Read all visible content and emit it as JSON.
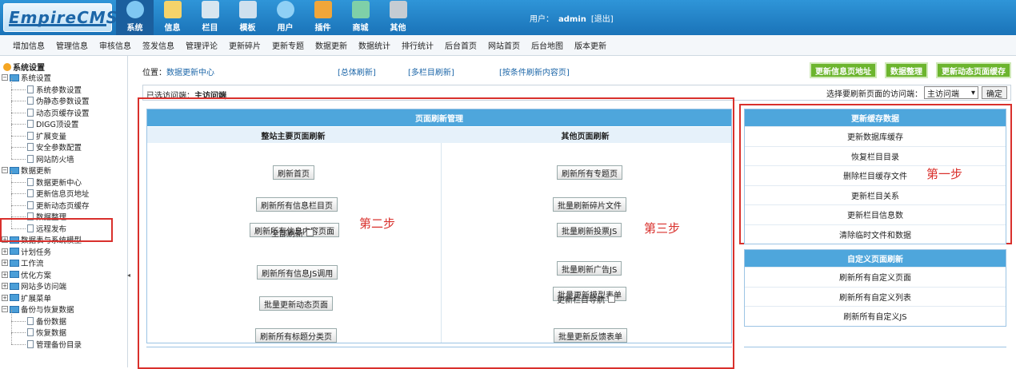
{
  "logo": {
    "text": "EmpireCMS"
  },
  "nav": [
    {
      "label": "系统",
      "icon": "globe-icon",
      "color": "#7fc7f2"
    },
    {
      "label": "信息",
      "icon": "edit-icon",
      "color": "#f5d36a"
    },
    {
      "label": "栏目",
      "icon": "folder-icon",
      "color": "#d7e6f0"
    },
    {
      "label": "模板",
      "icon": "template-icon",
      "color": "#cfe0ee"
    },
    {
      "label": "用户",
      "icon": "user-icon",
      "color": "#8fd0f5"
    },
    {
      "label": "插件",
      "icon": "tools-icon",
      "color": "#f0a63a"
    },
    {
      "label": "商城",
      "icon": "shop-icon",
      "color": "#7fd0a8"
    },
    {
      "label": "其他",
      "icon": "gear-icon",
      "color": "#c5ccd3"
    }
  ],
  "user": {
    "prefix": "用户：",
    "name": "admin",
    "logout": "[退出]"
  },
  "subnav": [
    "增加信息",
    "管理信息",
    "审核信息",
    "签发信息",
    "管理评论",
    "更新碎片",
    "更新专题",
    "数据更新",
    "数据统计",
    "排行统计",
    "后台首页",
    "网站首页",
    "后台地图",
    "版本更新"
  ],
  "sidebar": {
    "root": "系统设置",
    "items": [
      {
        "type": "folder",
        "label": "系统设置",
        "pm": "−"
      },
      {
        "type": "doc",
        "label": "系统参数设置"
      },
      {
        "type": "doc",
        "label": "伪静态参数设置"
      },
      {
        "type": "doc",
        "label": "动态页缓存设置"
      },
      {
        "type": "doc",
        "label": "DIGG顶设置"
      },
      {
        "type": "doc",
        "label": "扩展变量"
      },
      {
        "type": "doc",
        "label": "安全参数配置"
      },
      {
        "type": "doc",
        "label": "网站防火墙"
      },
      {
        "type": "folder",
        "label": "数据更新",
        "pm": "−"
      },
      {
        "type": "doc",
        "label": "数据更新中心"
      },
      {
        "type": "doc",
        "label": "更新信息页地址"
      },
      {
        "type": "doc",
        "label": "更新动态页缓存"
      },
      {
        "type": "doc",
        "label": "数据整理"
      },
      {
        "type": "doc",
        "label": "远程发布"
      },
      {
        "type": "folder",
        "label": "数据表与系统模型",
        "pm": "+"
      },
      {
        "type": "folder",
        "label": "计划任务",
        "pm": "+"
      },
      {
        "type": "folder",
        "label": "工作流",
        "pm": "+"
      },
      {
        "type": "folder",
        "label": "优化方案",
        "pm": "+"
      },
      {
        "type": "folder",
        "label": "网站多访问端",
        "pm": "+"
      },
      {
        "type": "folder",
        "label": "扩展菜单",
        "pm": "+"
      },
      {
        "type": "folder",
        "label": "备份与恢复数据",
        "pm": "−"
      },
      {
        "type": "doc",
        "label": "备份数据"
      },
      {
        "type": "doc",
        "label": "恢复数据"
      },
      {
        "type": "doc",
        "label": "管理备份目录"
      }
    ]
  },
  "main": {
    "position_label": "位置：",
    "position_link": "数据更新中心",
    "links": [
      "[总体刷新]",
      "[多栏目刷新]",
      "[按条件刷新内容页]"
    ],
    "top_buttons": [
      "更新信息页地址",
      "数据整理",
      "更新动态页面缓存"
    ],
    "selected_label": "已选访问端：",
    "selected_value": "主访问端",
    "select_label": "选择要刷新页面的访问端：",
    "select_value": "主访问端",
    "confirm": "确定"
  },
  "panel": {
    "title": "页面刷新管理",
    "left_header": "整站主要页面刷新",
    "right_header": "其他页面刷新",
    "left_buttons": [
      "刷新首页",
      "刷新所有信息栏目页",
      "刷新所有信息内容页面",
      "刷新所有信息JS调用",
      "批量更新动态页面",
      "刷新所有标题分类页"
    ],
    "left_check": "全部刷新",
    "right_buttons": [
      "刷新所有专题页",
      "批量刷新碎片文件",
      "批量刷新投票JS",
      "批量刷新广告JS",
      "批量更新模型表单",
      "批量更新反馈表单"
    ],
    "right_check": "更新栏目导航"
  },
  "steps": {
    "one": "第一步",
    "two": "第二步",
    "three": "第三步"
  },
  "cache_box": {
    "title": "更新缓存数据",
    "items": [
      "更新数据库缓存",
      "恢复栏目目录",
      "删除栏目缓存文件",
      "更新栏目关系",
      "更新栏目信息数",
      "清除临时文件和数据"
    ]
  },
  "custom_box": {
    "title": "自定义页面刷新",
    "items": [
      "刷新所有自定义页面",
      "刷新所有自定义列表",
      "刷新所有自定义JS"
    ]
  }
}
